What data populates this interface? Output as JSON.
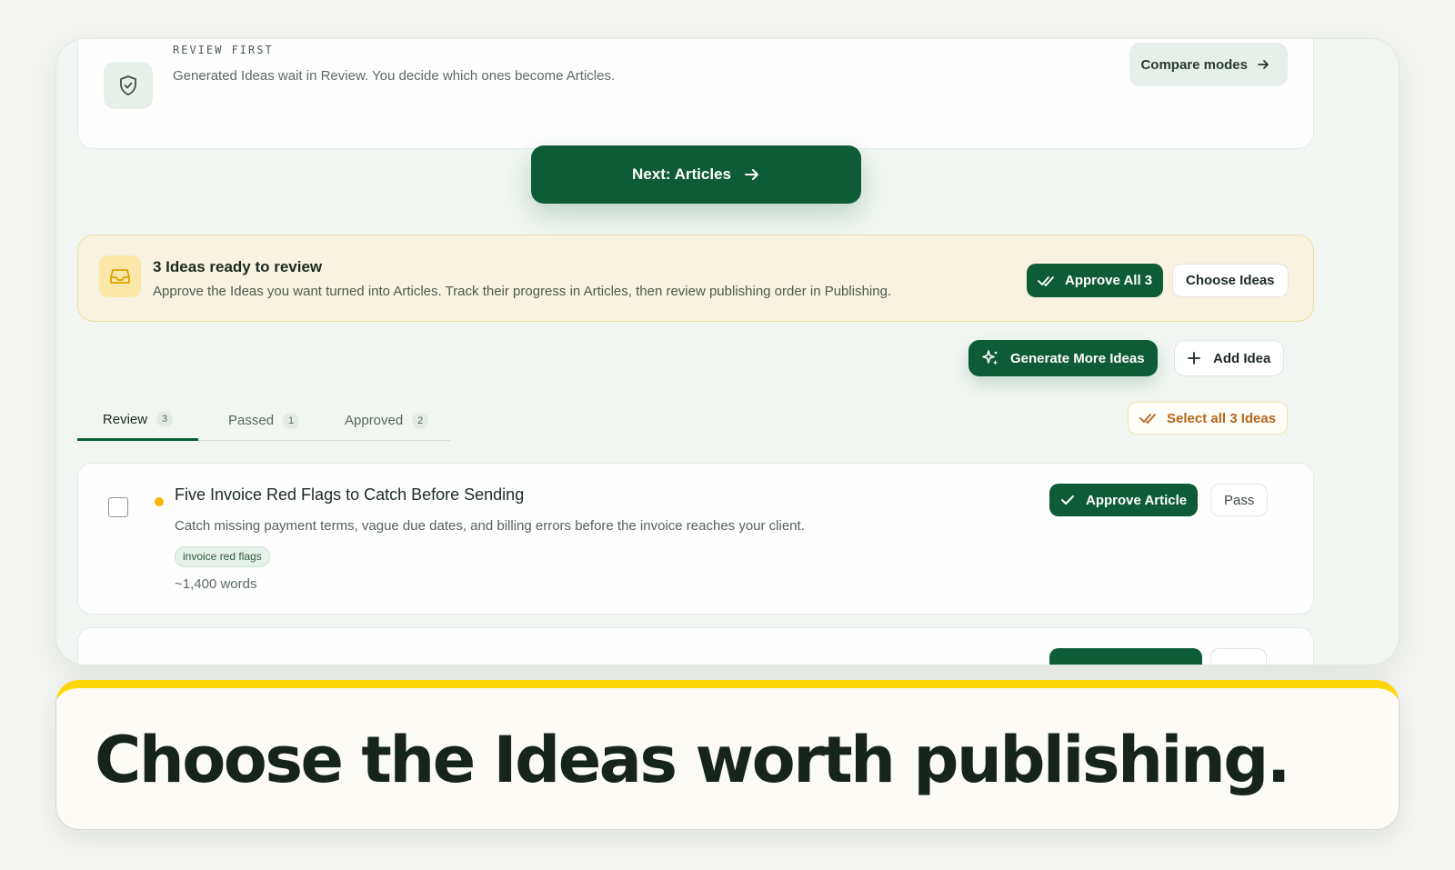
{
  "review_mode": {
    "eyebrow": "REVIEW FIRST",
    "description": "Generated Ideas wait in Review. You decide which ones become Articles.",
    "compare_label": "Compare modes",
    "icon": "shield-check-icon"
  },
  "next_button": {
    "label": "Next: Articles"
  },
  "ready_banner": {
    "title": "3 Ideas ready to review",
    "description": "Approve the Ideas you want turned into Articles. Track their progress in Articles, then review publishing order in Publishing.",
    "approve_all_label": "Approve All 3",
    "choose_label": "Choose Ideas",
    "icon": "inbox-icon"
  },
  "actions": {
    "generate_label": "Generate More Ideas",
    "add_label": "Add Idea"
  },
  "tabs": [
    {
      "label": "Review",
      "count": "3",
      "active": true
    },
    {
      "label": "Passed",
      "count": "1",
      "active": false
    },
    {
      "label": "Approved",
      "count": "2",
      "active": false
    }
  ],
  "select_all_label": "Select all 3 Ideas",
  "ideas": [
    {
      "title": "Five Invoice Red Flags to Catch Before Sending",
      "description": "Catch missing payment terms, vague due dates, and billing errors before the invoice reaches your client.",
      "tag": "invoice red flags",
      "words": "~1,400 words",
      "approve_label": "Approve Article",
      "pass_label": "Pass"
    }
  ],
  "caption": "Choose the Ideas worth publishing.",
  "colors": {
    "brand_green": "#0e5b37",
    "accent_yellow": "#ffd60a",
    "status_dot": "#f4b400",
    "select_all_text": "#b5651d"
  }
}
